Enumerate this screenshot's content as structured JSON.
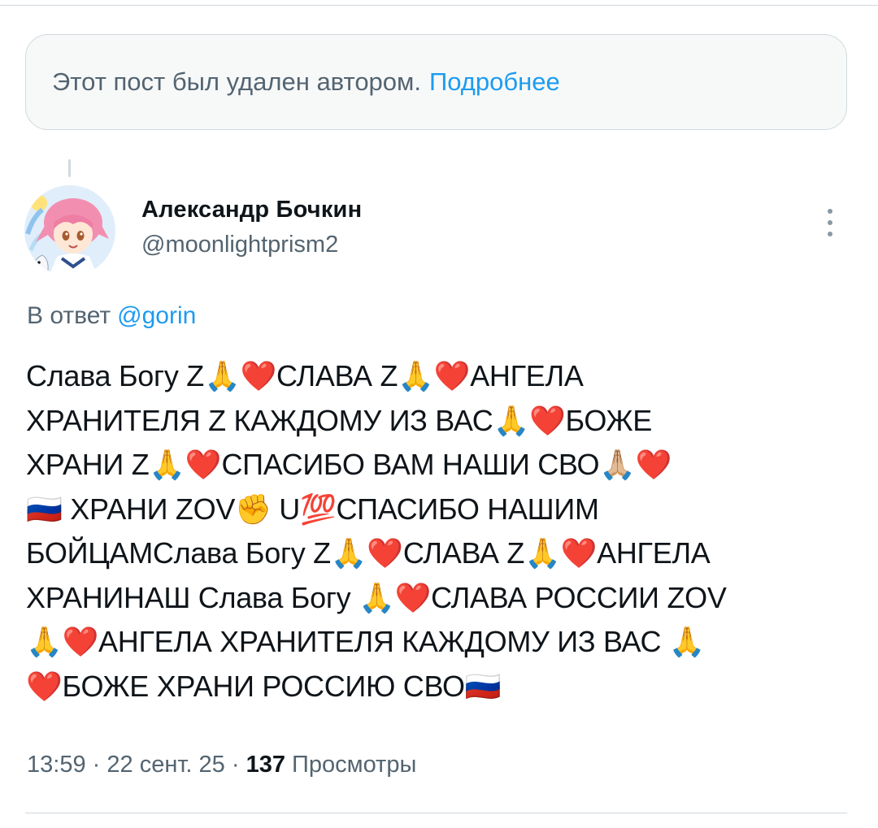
{
  "deleted_notice": {
    "text": "Этот пост был удален автором.",
    "link": "Подробнее"
  },
  "author": {
    "name": "Александр Бочкин",
    "handle": "@moonlightprism2"
  },
  "reply": {
    "prefix": "В ответ",
    "mention": "@gorin"
  },
  "tweet": {
    "text": "Слава Богу Z🙏❤️СЛАВА Z🙏❤️АНГЕЛА\nХРАНИТЕЛЯ Z КАЖДОМУ ИЗ ВАС🙏❤️БОЖЕ\nХРАНИ Z🙏❤️СПАСИБО ВАМ НАШИ СВО🙏🏼❤️\n🇷🇺 ХРАНИ ZOV✊     U💯СПАСИБО НАШИМ\nБОЙЦАМСлава Богу Z🙏❤️СЛАВА Z🙏❤️АНГЕЛА\nХРАНИНАШ Слава Богу 🙏❤️СЛАВА РОССИИ ZOV\n🙏❤️АНГЕЛА ХРАНИТЕЛЯ КАЖДОМУ ИЗ ВАС 🙏\n❤️БОЖЕ ХРАНИ РОССИЮ СВО🇷🇺"
  },
  "meta": {
    "time": "13:59",
    "date": "22 сент. 25",
    "views_count": "137",
    "views_label": "Просмотры",
    "separator": "·"
  },
  "colors": {
    "accent": "#1d9bf0",
    "secondary_text": "#536471",
    "border": "#cfd9de"
  },
  "icons": {
    "more": "more-vertical-icon"
  }
}
